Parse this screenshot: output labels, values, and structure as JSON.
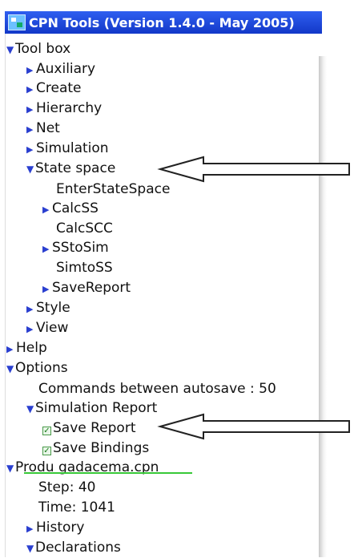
{
  "window": {
    "title": "CPN Tools (Version 1.4.0 - May 2005)"
  },
  "tree": {
    "toolbox": "Tool box",
    "auxiliary": "Auxiliary",
    "create": "Create",
    "hierarchy": "Hierarchy",
    "net": "Net",
    "simulation": "Simulation",
    "state_space": "State space",
    "enter_state_space": "EnterStateSpace",
    "calc_ss": "CalcSS",
    "calc_scc": "CalcSCC",
    "ss_to_sim": "SStoSim",
    "sim_to_ss": "SimtoSS",
    "save_report": "SaveReport",
    "style": "Style",
    "view": "View",
    "help": "Help",
    "options": "Options",
    "autosave": "Commands between autosave : 50",
    "simulation_report": "Simulation Report",
    "save_report_opt": "Save Report",
    "save_bindings_opt": "Save Bindings",
    "net_file": "Produ  gadacema.cpn",
    "step": "Step: 40",
    "time": "Time: 1041",
    "history": "History",
    "declarations": "Declarations"
  },
  "icons": {
    "expanded": "triangle-down-icon",
    "collapsed": "triangle-right-icon",
    "checked": "checkbox-checked-icon",
    "annotation": "left-arrow-callout"
  },
  "colors": {
    "titlebar": "#1f48e0",
    "triangle": "#2a3fd0",
    "underline": "#38c838"
  }
}
